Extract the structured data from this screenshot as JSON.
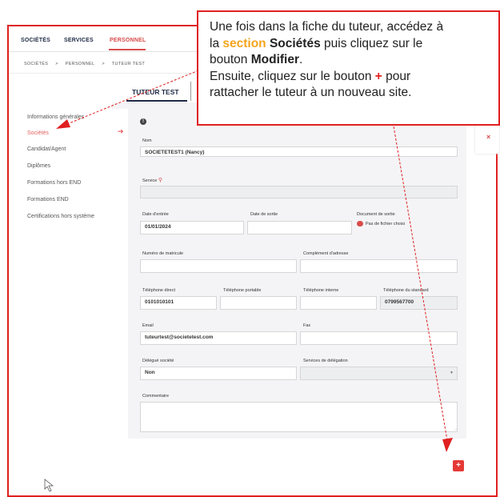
{
  "topnav": {
    "items": [
      "SOCIÉTÉS",
      "SERVICES",
      "PERSONNEL"
    ],
    "active": "PERSONNEL"
  },
  "breadcrumb": [
    "SOCIÉTÉS",
    ">",
    "PERSONNEL",
    ">",
    "TUTEUR TEST"
  ],
  "page_title": "TUTEUR TEST",
  "sidebar": {
    "items": [
      "Informations générales",
      "Sociétés",
      "Candidat/Agent",
      "Diplômes",
      "Formations hors END",
      "Formations END",
      "Certifications hors système"
    ],
    "active": "Sociétés"
  },
  "form": {
    "nom_label": "Nom",
    "nom_value": "SOCIETETEST1 (Nancy)",
    "service_label": "Service",
    "date_entree_label": "Date d'entrée",
    "date_entree_value": "01/01/2024",
    "date_sortie_label": "Date de sortie",
    "document_sortie_label": "Document de sortie",
    "document_sortie_value": "Pas de fichier choisi",
    "matricule_label": "Numéro de matricule",
    "complement_label": "Complément d'adresse",
    "tel_direct_label": "Téléphone direct",
    "tel_direct_value": "0101010101",
    "tel_portable_label": "Téléphone portable",
    "tel_interne_label": "Téléphone interne",
    "tel_standard_label": "Téléphone du standard",
    "tel_standard_value": "0799567700",
    "email_label": "Email",
    "email_value": "tuteurtest@societetest.com",
    "fax_label": "Fax",
    "delegue_label": "Délégué société",
    "delegue_value": "Non",
    "services_delegation_label": "Services de délégation",
    "commentaire_label": "Commentaire"
  },
  "callout": {
    "line1": "Une fois dans la fiche du tuteur, accédez à",
    "line2_pre": "la ",
    "line2_section": "section",
    "line2_societes": "Sociétés",
    "line2_post": " puis cliquez sur le",
    "line3_pre": "bouton ",
    "line3_modifier": "Modifier",
    "line3_post": ".",
    "line4_pre": "Ensuite, cliquez sur le bouton ",
    "line4_plus": "+",
    "line4_post": " pour",
    "line5": "rattacher le tuteur à un nouveau site."
  },
  "buttons": {
    "add": "+",
    "close": "×",
    "info": "!"
  },
  "colors": {
    "accent": "#d94b4b",
    "frame": "#e02020",
    "callout_highlight": "#f4a41c",
    "nav_text": "#1e2a44"
  }
}
